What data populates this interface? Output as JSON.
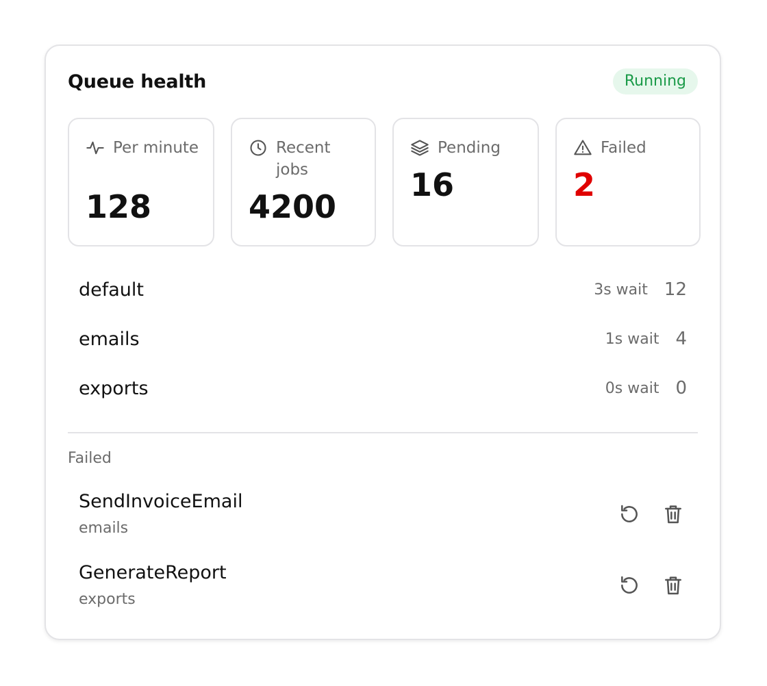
{
  "card": {
    "title": "Queue health",
    "status": "Running"
  },
  "stats": [
    {
      "label": "Per minute",
      "value": "128",
      "icon": "activity-icon"
    },
    {
      "label": "Recent jobs",
      "value": "4200",
      "icon": "clock-icon"
    },
    {
      "label": "Pending",
      "value": "16",
      "icon": "layers-icon"
    },
    {
      "label": "Failed",
      "value": "2",
      "icon": "warning-icon"
    }
  ],
  "queues": [
    {
      "name": "default",
      "wait": "3s wait",
      "count": "12"
    },
    {
      "name": "emails",
      "wait": "1s wait",
      "count": "4"
    },
    {
      "name": "exports",
      "wait": "0s wait",
      "count": "0"
    }
  ],
  "failed": {
    "heading": "Failed",
    "items": [
      {
        "job": "SendInvoiceEmail",
        "queue": "emails"
      },
      {
        "job": "GenerateReport",
        "queue": "exports"
      }
    ]
  },
  "colors": {
    "status_bg": "#e6f7ec",
    "status_text": "#1a9a48",
    "failed_value": "#e00000",
    "border": "#e3e3e6",
    "muted_text": "#6b6b6b"
  }
}
